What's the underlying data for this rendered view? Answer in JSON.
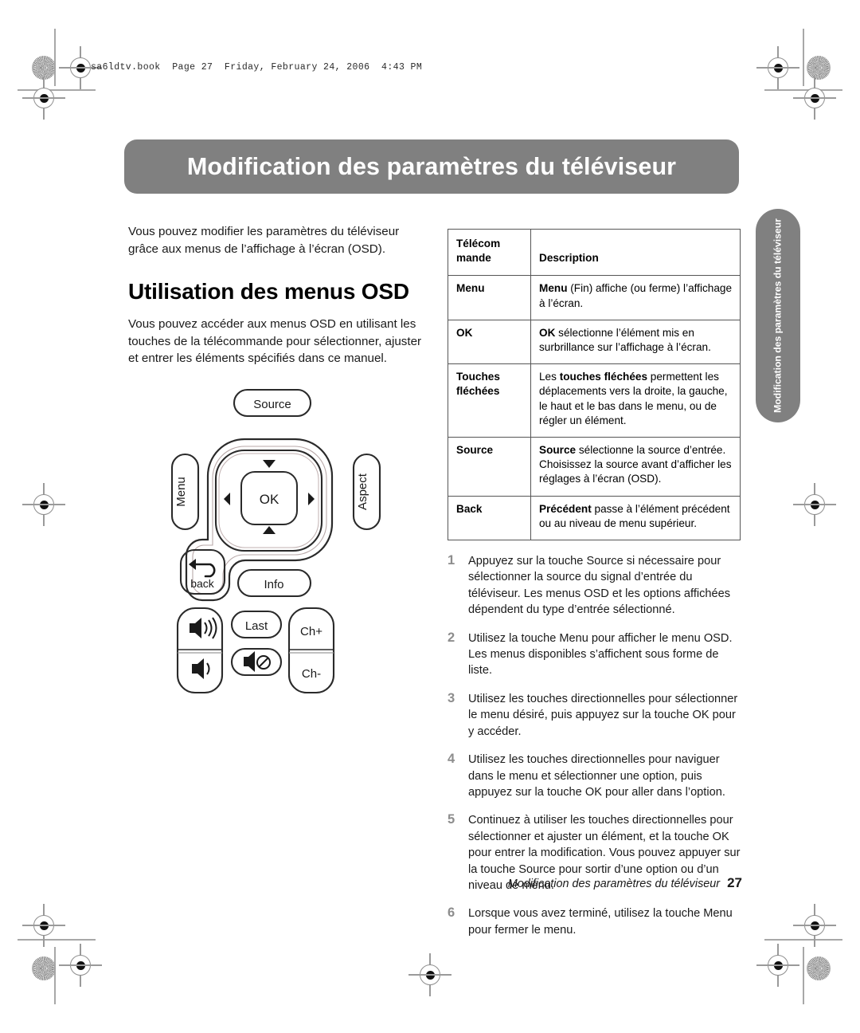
{
  "print_marks": {
    "file_info": "sa6ldtv.book  Page 27  Friday, February 24, 2006  4:43 PM"
  },
  "header": {
    "title": "Modification des paramètres du téléviseur"
  },
  "side_tab": {
    "label": "Modification des paramètres du téléviseur"
  },
  "left_column": {
    "intro": "Vous pouvez modifier les paramètres du téléviseur grâce aux menus de l’affichage à l’écran (OSD).",
    "heading": "Utilisation des menus OSD",
    "paragraph": "Vous pouvez accéder aux menus OSD en utilisant les touches de la télécommande pour sélectionner, ajuster et entrer les éléments spécifiés dans ce manuel."
  },
  "remote_diagram": {
    "buttons": {
      "source": "Source",
      "menu": "Menu",
      "aspect": "Aspect",
      "ok": "OK",
      "back": "back",
      "info": "Info",
      "last": "Last",
      "ch_up": "Ch+",
      "ch_down": "Ch-"
    }
  },
  "table": {
    "headers": {
      "col1": "Télécom mande",
      "col1_line1": "Télécom",
      "col1_line2": "mande",
      "col2": "Description"
    },
    "rows": [
      {
        "command": "Menu",
        "command_lines": [
          "Menu"
        ],
        "description_html": "<b>Menu</b> (Fin) affiche (ou ferme) l’affichage à l’écran."
      },
      {
        "command": "OK",
        "command_lines": [
          "OK"
        ],
        "description_html": "<b>OK</b> sélectionne l’élément mis en surbrillance sur l’affichage à l’écran."
      },
      {
        "command": "Touches fléchées",
        "command_lines": [
          "Touches",
          "fléchées"
        ],
        "description_html": "Les <b>touches fléchées</b> permettent les déplacements vers la droite, la gauche, le haut et le bas dans le menu, ou de régler un élément."
      },
      {
        "command": "Source",
        "command_lines": [
          "Source"
        ],
        "description_html": "<b>Source</b> sélectionne la source d’entrée. Choisissez la source avant d’afficher les réglages à l’écran (OSD)."
      },
      {
        "command": "Back",
        "command_lines": [
          "Back"
        ],
        "description_html": "<b>Précédent</b> passe à l’élément précédent ou au niveau de menu supérieur."
      }
    ]
  },
  "steps": [
    {
      "number": "1",
      "text": "Appuyez sur la touche Source si nécessaire pour sélectionner la source du signal d’entrée du téléviseur. Les menus OSD et les options affichées dépendent du type d’entrée sélectionné."
    },
    {
      "number": "2",
      "text": "Utilisez la touche Menu pour afficher le menu OSD. Les menus disponibles s’affichent sous forme de liste."
    },
    {
      "number": "3",
      "text": "Utilisez les touches directionnelles pour sélectionner le menu désiré, puis appuyez sur la touche OK pour y accéder."
    },
    {
      "number": "4",
      "text": "Utilisez les touches directionnelles pour naviguer dans le menu et sélectionner une option, puis appuyez sur la touche OK pour aller dans l’option."
    },
    {
      "number": "5",
      "text": "Continuez à utiliser les touches directionnelles pour sélectionner et ajuster un élément, et la touche OK pour entrer la modification. Vous pouvez appuyer sur la touche Source pour sortir d’une option ou d’un niveau de menu."
    },
    {
      "number": "6",
      "text": "Lorsque vous avez terminé, utilisez la touche Menu pour fermer le menu."
    }
  ],
  "footer": {
    "running_title": "Modification des paramètres du téléviseur",
    "page_number": "27"
  },
  "colors": {
    "banner_gray": "#808080",
    "rule_gray": "#565656",
    "step_number_gray": "#8d8d8d"
  }
}
